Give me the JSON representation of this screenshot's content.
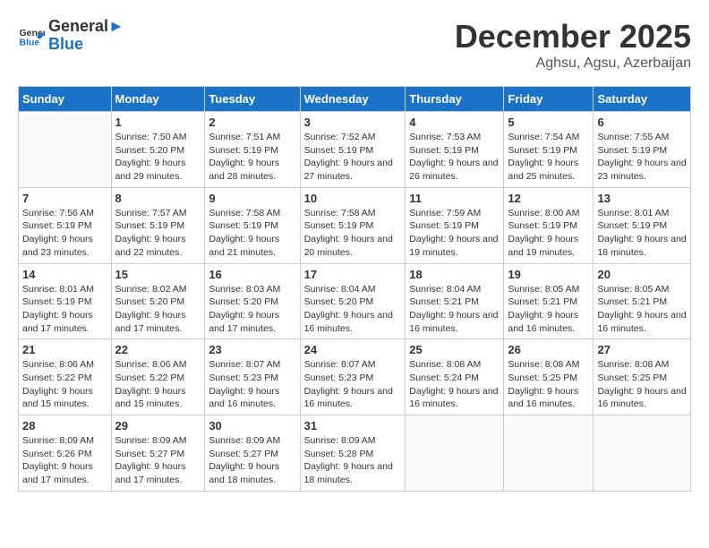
{
  "header": {
    "logo_line1": "General",
    "logo_line2": "Blue",
    "month_title": "December 2025",
    "subtitle": "Aghsu, Agsu, Azerbaijan"
  },
  "weekdays": [
    "Sunday",
    "Monday",
    "Tuesday",
    "Wednesday",
    "Thursday",
    "Friday",
    "Saturday"
  ],
  "weeks": [
    [
      {
        "day": "",
        "sunrise": "",
        "sunset": "",
        "daylight": ""
      },
      {
        "day": "1",
        "sunrise": "Sunrise: 7:50 AM",
        "sunset": "Sunset: 5:20 PM",
        "daylight": "Daylight: 9 hours and 29 minutes."
      },
      {
        "day": "2",
        "sunrise": "Sunrise: 7:51 AM",
        "sunset": "Sunset: 5:19 PM",
        "daylight": "Daylight: 9 hours and 28 minutes."
      },
      {
        "day": "3",
        "sunrise": "Sunrise: 7:52 AM",
        "sunset": "Sunset: 5:19 PM",
        "daylight": "Daylight: 9 hours and 27 minutes."
      },
      {
        "day": "4",
        "sunrise": "Sunrise: 7:53 AM",
        "sunset": "Sunset: 5:19 PM",
        "daylight": "Daylight: 9 hours and 26 minutes."
      },
      {
        "day": "5",
        "sunrise": "Sunrise: 7:54 AM",
        "sunset": "Sunset: 5:19 PM",
        "daylight": "Daylight: 9 hours and 25 minutes."
      },
      {
        "day": "6",
        "sunrise": "Sunrise: 7:55 AM",
        "sunset": "Sunset: 5:19 PM",
        "daylight": "Daylight: 9 hours and 23 minutes."
      }
    ],
    [
      {
        "day": "7",
        "sunrise": "Sunrise: 7:56 AM",
        "sunset": "Sunset: 5:19 PM",
        "daylight": "Daylight: 9 hours and 23 minutes."
      },
      {
        "day": "8",
        "sunrise": "Sunrise: 7:57 AM",
        "sunset": "Sunset: 5:19 PM",
        "daylight": "Daylight: 9 hours and 22 minutes."
      },
      {
        "day": "9",
        "sunrise": "Sunrise: 7:58 AM",
        "sunset": "Sunset: 5:19 PM",
        "daylight": "Daylight: 9 hours and 21 minutes."
      },
      {
        "day": "10",
        "sunrise": "Sunrise: 7:58 AM",
        "sunset": "Sunset: 5:19 PM",
        "daylight": "Daylight: 9 hours and 20 minutes."
      },
      {
        "day": "11",
        "sunrise": "Sunrise: 7:59 AM",
        "sunset": "Sunset: 5:19 PM",
        "daylight": "Daylight: 9 hours and 19 minutes."
      },
      {
        "day": "12",
        "sunrise": "Sunrise: 8:00 AM",
        "sunset": "Sunset: 5:19 PM",
        "daylight": "Daylight: 9 hours and 19 minutes."
      },
      {
        "day": "13",
        "sunrise": "Sunrise: 8:01 AM",
        "sunset": "Sunset: 5:19 PM",
        "daylight": "Daylight: 9 hours and 18 minutes."
      }
    ],
    [
      {
        "day": "14",
        "sunrise": "Sunrise: 8:01 AM",
        "sunset": "Sunset: 5:19 PM",
        "daylight": "Daylight: 9 hours and 17 minutes."
      },
      {
        "day": "15",
        "sunrise": "Sunrise: 8:02 AM",
        "sunset": "Sunset: 5:20 PM",
        "daylight": "Daylight: 9 hours and 17 minutes."
      },
      {
        "day": "16",
        "sunrise": "Sunrise: 8:03 AM",
        "sunset": "Sunset: 5:20 PM",
        "daylight": "Daylight: 9 hours and 17 minutes."
      },
      {
        "day": "17",
        "sunrise": "Sunrise: 8:04 AM",
        "sunset": "Sunset: 5:20 PM",
        "daylight": "Daylight: 9 hours and 16 minutes."
      },
      {
        "day": "18",
        "sunrise": "Sunrise: 8:04 AM",
        "sunset": "Sunset: 5:21 PM",
        "daylight": "Daylight: 9 hours and 16 minutes."
      },
      {
        "day": "19",
        "sunrise": "Sunrise: 8:05 AM",
        "sunset": "Sunset: 5:21 PM",
        "daylight": "Daylight: 9 hours and 16 minutes."
      },
      {
        "day": "20",
        "sunrise": "Sunrise: 8:05 AM",
        "sunset": "Sunset: 5:21 PM",
        "daylight": "Daylight: 9 hours and 16 minutes."
      }
    ],
    [
      {
        "day": "21",
        "sunrise": "Sunrise: 8:06 AM",
        "sunset": "Sunset: 5:22 PM",
        "daylight": "Daylight: 9 hours and 15 minutes."
      },
      {
        "day": "22",
        "sunrise": "Sunrise: 8:06 AM",
        "sunset": "Sunset: 5:22 PM",
        "daylight": "Daylight: 9 hours and 15 minutes."
      },
      {
        "day": "23",
        "sunrise": "Sunrise: 8:07 AM",
        "sunset": "Sunset: 5:23 PM",
        "daylight": "Daylight: 9 hours and 16 minutes."
      },
      {
        "day": "24",
        "sunrise": "Sunrise: 8:07 AM",
        "sunset": "Sunset: 5:23 PM",
        "daylight": "Daylight: 9 hours and 16 minutes."
      },
      {
        "day": "25",
        "sunrise": "Sunrise: 8:08 AM",
        "sunset": "Sunset: 5:24 PM",
        "daylight": "Daylight: 9 hours and 16 minutes."
      },
      {
        "day": "26",
        "sunrise": "Sunrise: 8:08 AM",
        "sunset": "Sunset: 5:25 PM",
        "daylight": "Daylight: 9 hours and 16 minutes."
      },
      {
        "day": "27",
        "sunrise": "Sunrise: 8:08 AM",
        "sunset": "Sunset: 5:25 PM",
        "daylight": "Daylight: 9 hours and 16 minutes."
      }
    ],
    [
      {
        "day": "28",
        "sunrise": "Sunrise: 8:09 AM",
        "sunset": "Sunset: 5:26 PM",
        "daylight": "Daylight: 9 hours and 17 minutes."
      },
      {
        "day": "29",
        "sunrise": "Sunrise: 8:09 AM",
        "sunset": "Sunset: 5:27 PM",
        "daylight": "Daylight: 9 hours and 17 minutes."
      },
      {
        "day": "30",
        "sunrise": "Sunrise: 8:09 AM",
        "sunset": "Sunset: 5:27 PM",
        "daylight": "Daylight: 9 hours and 18 minutes."
      },
      {
        "day": "31",
        "sunrise": "Sunrise: 8:09 AM",
        "sunset": "Sunset: 5:28 PM",
        "daylight": "Daylight: 9 hours and 18 minutes."
      },
      {
        "day": "",
        "sunrise": "",
        "sunset": "",
        "daylight": ""
      },
      {
        "day": "",
        "sunrise": "",
        "sunset": "",
        "daylight": ""
      },
      {
        "day": "",
        "sunrise": "",
        "sunset": "",
        "daylight": ""
      }
    ]
  ]
}
